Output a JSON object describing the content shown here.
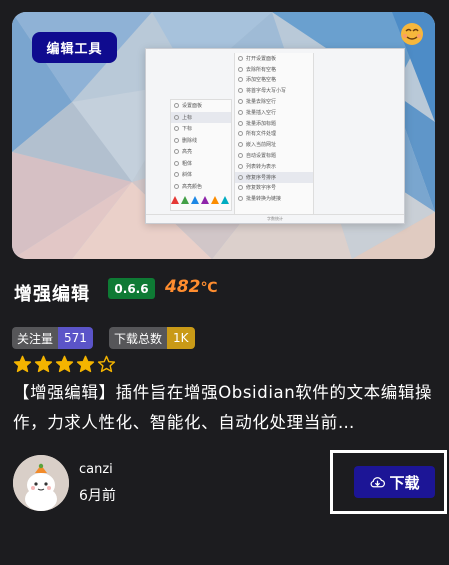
{
  "cover": {
    "tag_label": "编辑工具",
    "emoji_icon": "face-emoji-icon",
    "screenshot": {
      "right_menu": [
        "打开设置面板",
        "去除所有空格",
        "添加空格空格",
        "将首字母大写小写",
        "批量去除空行",
        "批量插入空行",
        "批量添加标题",
        "所有文件处理",
        "嵌入当前网址",
        "自动设置标题",
        "列表转为表示",
        "修复序号排序",
        "修复数字序号",
        "批量转换为链接"
      ],
      "left_menu": [
        "设置面板",
        "上标",
        "下标",
        "删除线",
        "高亮",
        "粗体",
        "斜体",
        "高亮颜色"
      ],
      "status": "字数统计"
    }
  },
  "plugin": {
    "title": "增强编辑",
    "version": "0.6.6",
    "heat_value": "482",
    "heat_unit": "℃"
  },
  "stats": {
    "follow_label": "关注量",
    "follow_count": "571",
    "downloads_label": "下载总数",
    "downloads_count": "1K"
  },
  "rating": {
    "value": 4,
    "max": 5,
    "color": "#f4b400"
  },
  "description": "【增强编辑】插件旨在增强Obsidian软件的文本编辑操作，力求人性化、智能化、自动化处理当前…",
  "author": {
    "name": "canzi",
    "time": "6月前"
  },
  "actions": {
    "download_label": "下载",
    "download_icon": "cloud-download-icon"
  },
  "colors": {
    "background": "#1c1c1f",
    "tag_bg": "#0f0b8f",
    "version_bg": "#0e7a34",
    "heat": "#ff8d2f",
    "follow_badge": "#5b54c8",
    "downloads_badge": "#c99a17",
    "download_button": "#1c1596"
  }
}
